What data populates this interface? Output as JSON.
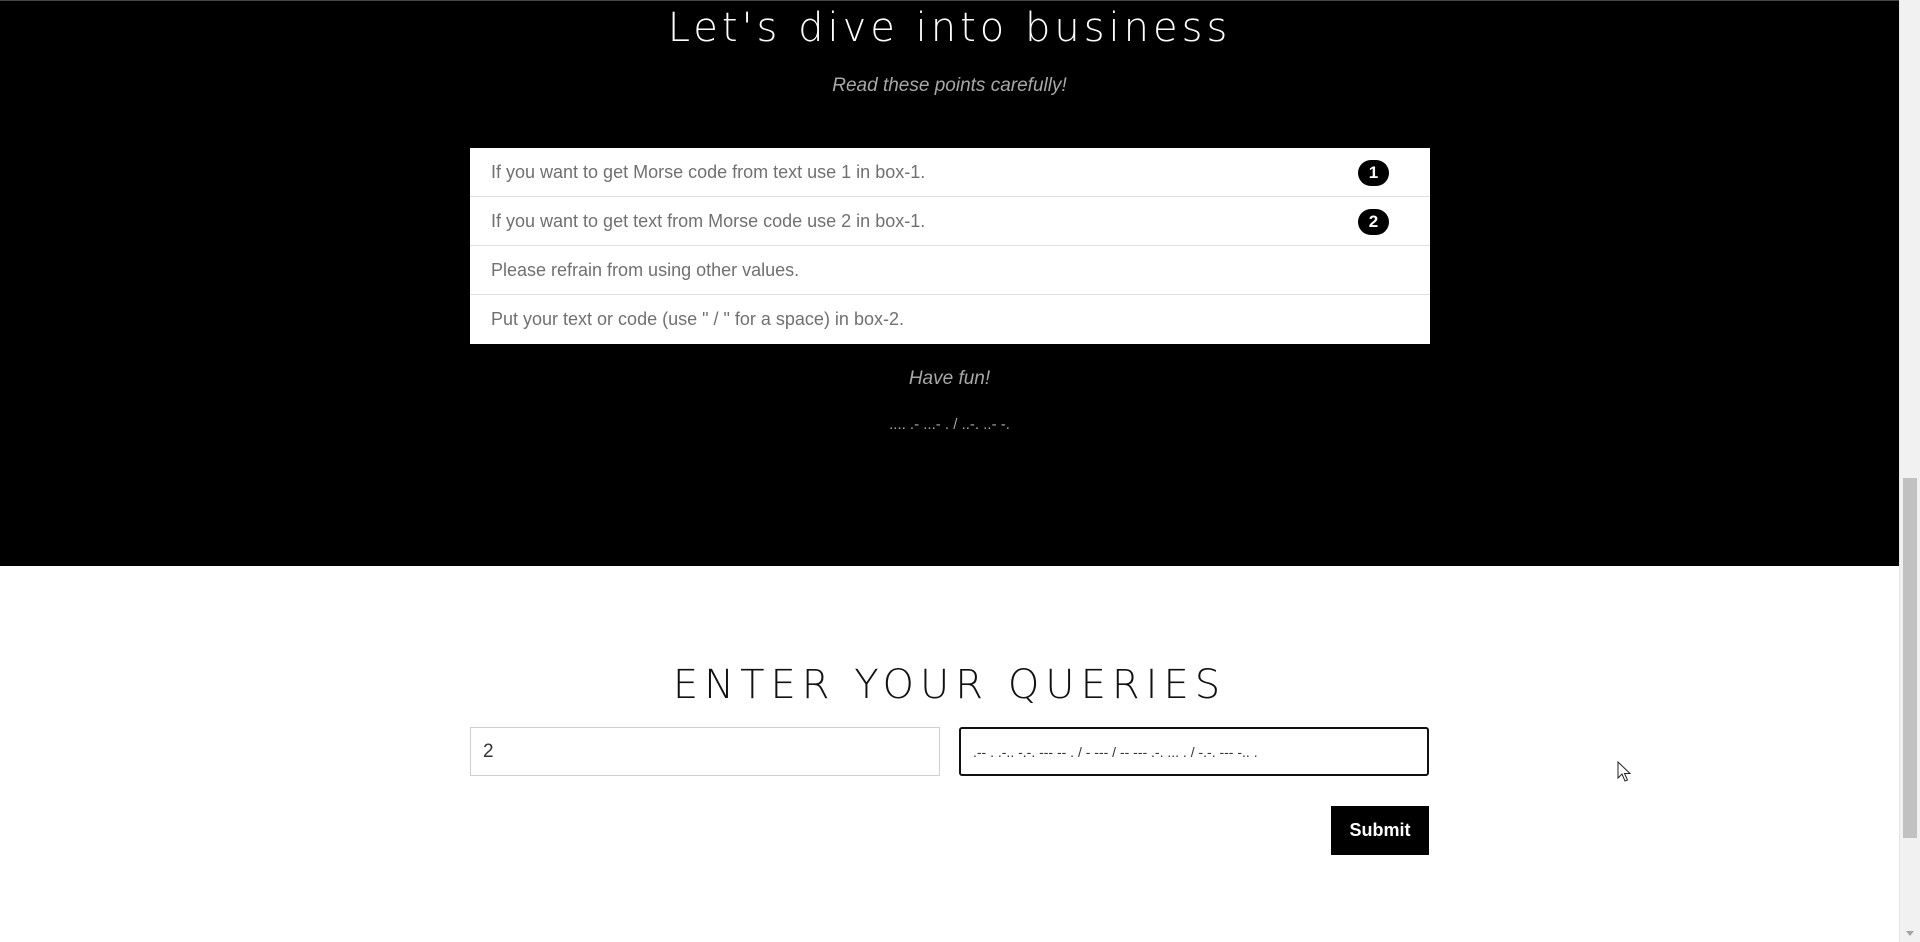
{
  "business_section": {
    "title": "Let's dive into business",
    "subtitle": "Read these points carefully!",
    "points": [
      {
        "text": "If you want to get Morse code from text use 1 in box-1.",
        "badge": "1"
      },
      {
        "text": "If you want to get text from Morse code use 2 in box-1.",
        "badge": "2"
      },
      {
        "text": "Please refrain from using other values.",
        "badge": ""
      },
      {
        "text": "Put your text or code (use \" / \" for a space) in box-2.",
        "badge": ""
      }
    ],
    "closing": "Have fun!",
    "morse_sign": ".... .- ...- . / ..-. ..- -."
  },
  "query_section": {
    "title": "ENTER YOUR QUERIES",
    "box1_value": "2",
    "box2_value": ".-- . .-.. -.-. --- -- . / - --- / -- --- .-. ... . / -.-. --- -.. .",
    "submit_label": "Submit"
  },
  "icons": {
    "cursor": "mouse-pointer-icon"
  }
}
